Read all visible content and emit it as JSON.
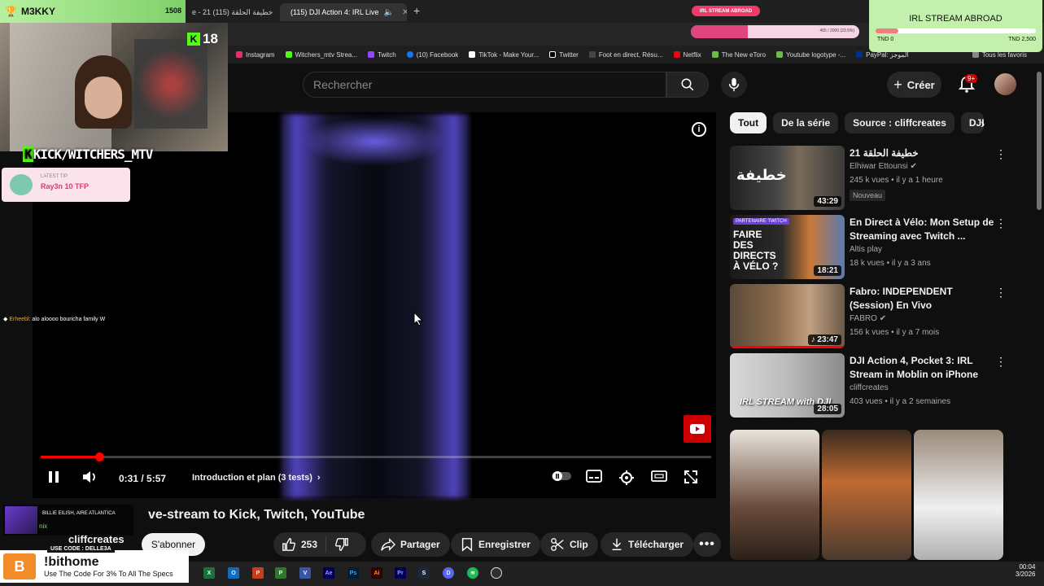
{
  "browser": {
    "tabs": [
      {
        "label": "e - 21 خطيفة الحلقة (115)",
        "active": false
      },
      {
        "label": "(115) DJI Action 4: IRL Live",
        "active": true
      }
    ],
    "bookmarks": [
      "Instagram",
      "Witchers_mtv Strea...",
      "Twitch",
      "(10) Facebook",
      "TikTok - Make Your...",
      "Twitter",
      "Foot en direct, Résu...",
      "Netflix",
      "The New eToro",
      "Youtube logotype -...",
      "PayPal: الموجز"
    ],
    "bookmark_colors": [
      "#e1306c",
      "#53fc18",
      "#9146ff",
      "#1877f2",
      "#ffffff",
      "#ffffff",
      "#ffffff",
      "#e50914",
      "#6cbd45",
      "#6cbd45",
      "#003087"
    ],
    "all_bookmarks": "Tous les favoris"
  },
  "youtube": {
    "search_placeholder": "Rechercher",
    "create_label": "Créer",
    "notif_count": "9+",
    "chips": [
      "Tout",
      "De la série",
      "Source : cliffcreates",
      "DJI"
    ],
    "player": {
      "time": "0:31 / 5:57",
      "chapter": "Introduction et plan (3 tests)",
      "progress": 0.087
    },
    "video_title": "ve-stream to Kick, Twitch, YouTube",
    "channel": "cliffcreates",
    "subscribe_label": "S'abonner",
    "likes": "253",
    "actions": {
      "share": "Partager",
      "save": "Enregistrer",
      "clip": "Clip",
      "download": "Télécharger"
    },
    "recommendations": [
      {
        "title": "خطيفة الحلقة 21",
        "channel": "Elhiwar Ettounsi",
        "verified": true,
        "meta": "245 k vues • il y a 1 heure",
        "duration": "43:29",
        "badge": "Nouveau",
        "thumb_text": "خطيفة"
      },
      {
        "title": "En Direct à Vélo: Mon Setup de Streaming avec Twitch ...",
        "channel": "Altis play",
        "meta": "18 k vues • il y a 3 ans",
        "duration": "18:21",
        "thumb_text": "FAIRE DES DIRECTS À VÉLO ?",
        "thumb_tag": "PARTENAIRE TWITCH"
      },
      {
        "title": "Fabro: INDEPENDENT (Session) En Vivo",
        "channel": "FABRO",
        "verified": true,
        "meta": "156 k vues • il y a 7 mois",
        "duration": "23:47"
      },
      {
        "title": "DJI Action 4, Pocket 3: IRL Stream in Moblin on iPhone",
        "channel": "cliffcreates",
        "meta": "403 vues • il y a 2 semaines",
        "duration": "28:05",
        "thumb_text": "IRL STREAM with DJI"
      }
    ]
  },
  "overlay": {
    "streamer": "M3KKY",
    "viewer_count": "1508",
    "age": "18",
    "kick_handle": "KICK/WITCHERS_MTV",
    "tip_label": "LATEST TIP",
    "tip_text": "Ray3n 10 TFP",
    "chat_user": "Erheebl",
    "chat_message": ": alo aloooo bouricha family W",
    "goal_title": "IRL STREAM ABROAD",
    "goal_min": "TND 0",
    "goal_max": "TND 2,500",
    "goal_progress": 0.14,
    "mid_badge": "IRL STREAM ABROAD",
    "mid_bar_text": "465 / 2000 (23.5%)",
    "mid_progress": 0.34,
    "song": "BILLIE EILISH, AIRE ATLANTICA",
    "song_sub": "nix",
    "promo_code": "USE CODE : DELLE3A",
    "promo_cmd": "!bithome",
    "promo_desc": "Use The Code For 3% To All The Specs"
  },
  "taskbar": {
    "icons": [
      "excel-icon",
      "outlook-icon",
      "powerpoint-icon",
      "project-icon",
      "visio-icon",
      "after-effects-icon",
      "photoshop-icon",
      "illustrator-icon",
      "premiere-icon",
      "steam-icon",
      "discord-icon",
      "spotify-icon",
      "obs-icon"
    ],
    "time": "00:04",
    "date": "3/2026"
  }
}
